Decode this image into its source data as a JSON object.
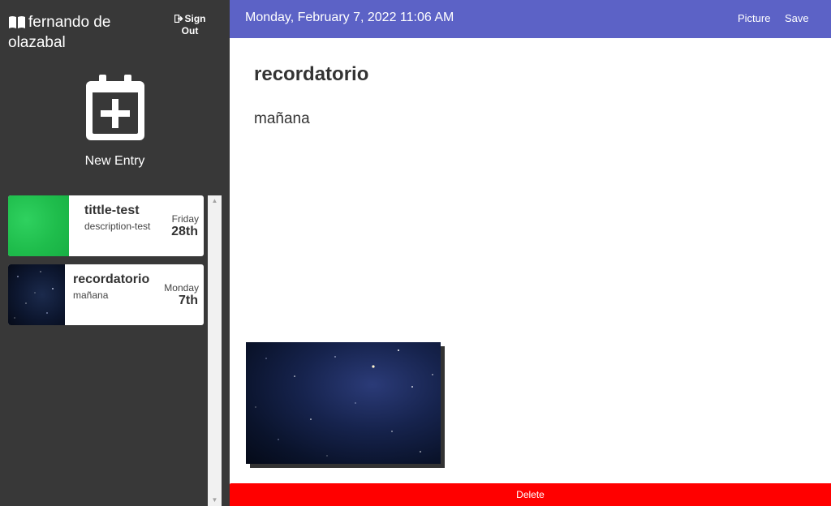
{
  "sidebar": {
    "user_name": "fernando de olazabal",
    "sign_out_label": "Sign Out",
    "new_entry_label": "New Entry",
    "entries": [
      {
        "title": "tittle-test",
        "description": "description-test",
        "day": "Friday",
        "date": "28th",
        "thumb_color": "#22c453"
      },
      {
        "title": "recordatorio",
        "description": "mañana",
        "day": "Monday",
        "date": "7th",
        "thumb_color": "#0b1530"
      }
    ]
  },
  "header": {
    "datetime": "Monday, February 7, 2022 11:06 AM",
    "picture_label": "Picture",
    "save_label": "Save"
  },
  "main": {
    "title": "recordatorio",
    "body": "mañana",
    "delete_label": "Delete"
  },
  "colors": {
    "sidebar_bg": "#383838",
    "header_bg": "#5c62c6",
    "delete_bg": "#ff0000"
  }
}
